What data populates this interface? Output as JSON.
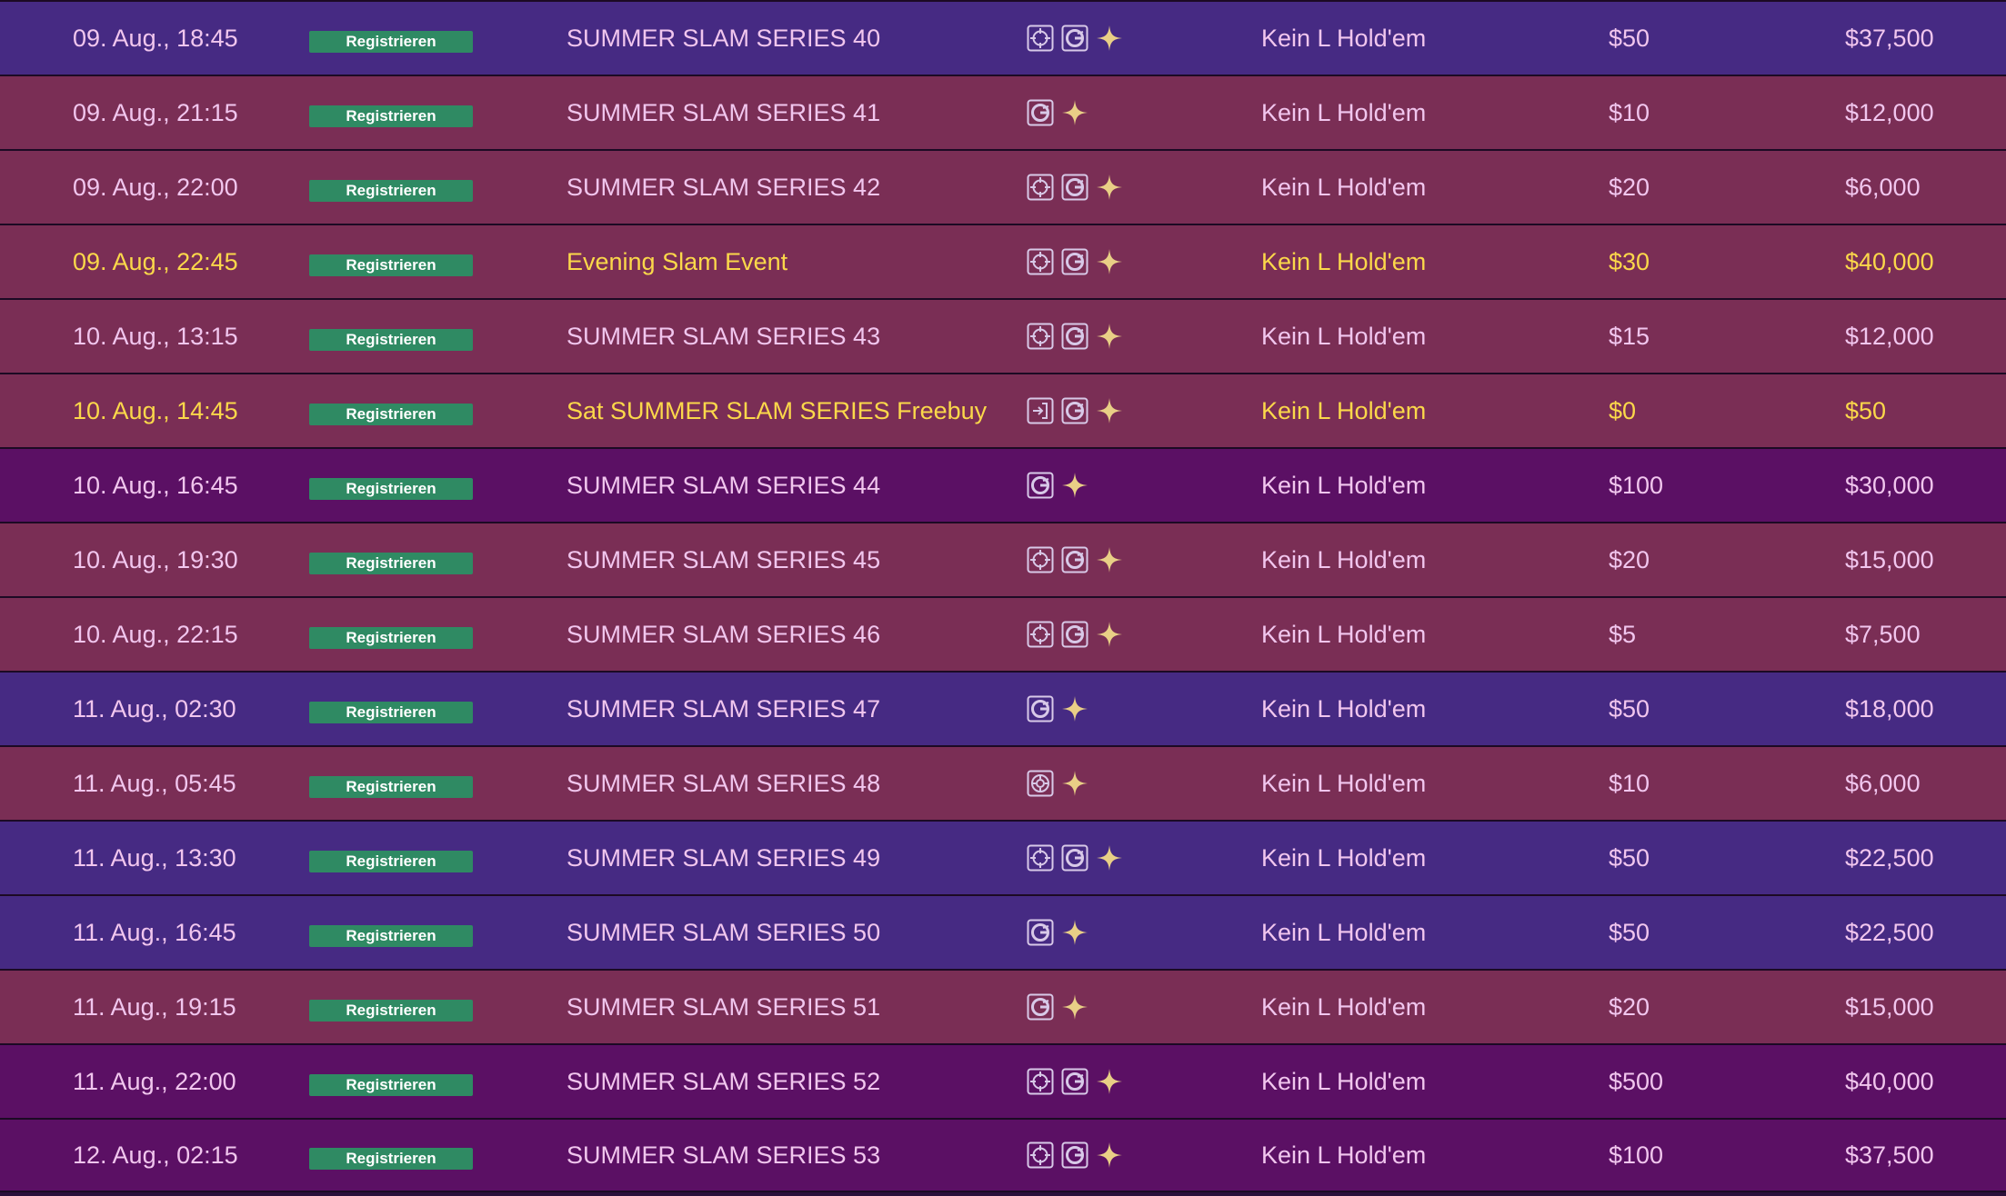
{
  "register_label": "Registrieren",
  "rows": [
    {
      "date": "09. Aug., 18:45",
      "name": "SUMMER SLAM SERIES 40",
      "game": "Kein L Hold'em",
      "buyin": "$50",
      "prize": "$37,500",
      "bg": "blue",
      "highlight": false,
      "icons": [
        "crosshair-icon",
        "turbo-g-icon",
        "sparkle-icon"
      ]
    },
    {
      "date": "09. Aug., 21:15",
      "name": "SUMMER SLAM SERIES 41",
      "game": "Kein L Hold'em",
      "buyin": "$10",
      "prize": "$12,000",
      "bg": "maroon",
      "highlight": false,
      "icons": [
        "turbo-g-icon",
        "sparkle-icon"
      ]
    },
    {
      "date": "09. Aug., 22:00",
      "name": "SUMMER SLAM SERIES 42",
      "game": "Kein L Hold'em",
      "buyin": "$20",
      "prize": "$6,000",
      "bg": "maroon",
      "highlight": false,
      "icons": [
        "crosshair-icon",
        "turbo-g-icon",
        "sparkle-icon"
      ]
    },
    {
      "date": "09. Aug., 22:45",
      "name": "Evening Slam Event",
      "game": "Kein L Hold'em",
      "buyin": "$30",
      "prize": "$40,000",
      "bg": "maroon",
      "highlight": true,
      "icons": [
        "crosshair-icon",
        "turbo-g-icon",
        "sparkle-icon"
      ]
    },
    {
      "date": "10. Aug., 13:15",
      "name": "SUMMER SLAM SERIES 43",
      "game": "Kein L Hold'em",
      "buyin": "$15",
      "prize": "$12,000",
      "bg": "maroon",
      "highlight": false,
      "icons": [
        "crosshair-icon",
        "turbo-g-icon",
        "sparkle-icon"
      ]
    },
    {
      "date": "10. Aug., 14:45",
      "name": "Sat SUMMER SLAM SERIES Freebuy",
      "game": "Kein L Hold'em",
      "buyin": "$0",
      "prize": "$50",
      "bg": "maroon",
      "highlight": true,
      "icons": [
        "enter-icon",
        "turbo-g-icon",
        "sparkle-icon"
      ]
    },
    {
      "date": "10. Aug., 16:45",
      "name": "SUMMER SLAM SERIES 44",
      "game": "Kein L Hold'em",
      "buyin": "$100",
      "prize": "$30,000",
      "bg": "purple",
      "highlight": false,
      "icons": [
        "turbo-g-icon",
        "sparkle-icon"
      ]
    },
    {
      "date": "10. Aug., 19:30",
      "name": "SUMMER SLAM SERIES 45",
      "game": "Kein L Hold'em",
      "buyin": "$20",
      "prize": "$15,000",
      "bg": "maroon",
      "highlight": false,
      "icons": [
        "crosshair-icon",
        "turbo-g-icon",
        "sparkle-icon"
      ]
    },
    {
      "date": "10. Aug., 22:15",
      "name": "SUMMER SLAM SERIES 46",
      "game": "Kein L Hold'em",
      "buyin": "$5",
      "prize": "$7,500",
      "bg": "maroon",
      "highlight": false,
      "icons": [
        "crosshair-icon",
        "turbo-g-icon",
        "sparkle-icon"
      ]
    },
    {
      "date": "11. Aug., 02:30",
      "name": "SUMMER SLAM SERIES 47",
      "game": "Kein L Hold'em",
      "buyin": "$50",
      "prize": "$18,000",
      "bg": "blue",
      "highlight": false,
      "icons": [
        "turbo-g-icon",
        "sparkle-icon"
      ]
    },
    {
      "date": "11. Aug., 05:45",
      "name": "SUMMER SLAM SERIES 48",
      "game": "Kein L Hold'em",
      "buyin": "$10",
      "prize": "$6,000",
      "bg": "maroon",
      "highlight": false,
      "icons": [
        "chip-icon",
        "sparkle-icon"
      ]
    },
    {
      "date": "11. Aug., 13:30",
      "name": "SUMMER SLAM SERIES 49",
      "game": "Kein L Hold'em",
      "buyin": "$50",
      "prize": "$22,500",
      "bg": "blue",
      "highlight": false,
      "icons": [
        "crosshair-icon",
        "turbo-g-icon",
        "sparkle-icon"
      ]
    },
    {
      "date": "11. Aug., 16:45",
      "name": "SUMMER SLAM SERIES 50",
      "game": "Kein L Hold'em",
      "buyin": "$50",
      "prize": "$22,500",
      "bg": "blue",
      "highlight": false,
      "icons": [
        "turbo-g-icon",
        "sparkle-icon"
      ]
    },
    {
      "date": "11. Aug., 19:15",
      "name": "SUMMER SLAM SERIES 51",
      "game": "Kein L Hold'em",
      "buyin": "$20",
      "prize": "$15,000",
      "bg": "maroon",
      "highlight": false,
      "icons": [
        "turbo-g-icon",
        "sparkle-icon"
      ]
    },
    {
      "date": "11. Aug., 22:00",
      "name": "SUMMER SLAM SERIES 52",
      "game": "Kein L Hold'em",
      "buyin": "$500",
      "prize": "$40,000",
      "bg": "purple",
      "highlight": false,
      "icons": [
        "crosshair-icon",
        "turbo-g-icon",
        "sparkle-icon"
      ]
    },
    {
      "date": "12. Aug., 02:15",
      "name": "SUMMER SLAM SERIES 53",
      "game": "Kein L Hold'em",
      "buyin": "$100",
      "prize": "$37,500",
      "bg": "purple",
      "highlight": false,
      "icons": [
        "crosshair-icon",
        "turbo-g-icon",
        "sparkle-icon"
      ]
    }
  ]
}
